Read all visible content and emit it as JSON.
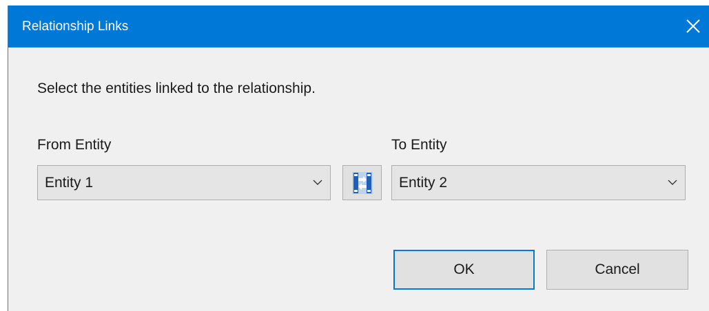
{
  "dialog": {
    "title": "Relationship Links",
    "instruction": "Select the entities linked to the relationship.",
    "from": {
      "label": "From Entity",
      "selected": "Entity 1"
    },
    "to": {
      "label": "To Entity",
      "selected": "Entity 2"
    },
    "buttons": {
      "ok": "OK",
      "cancel": "Cancel"
    },
    "icons": {
      "close": "close-icon",
      "swap": "swap-entities-icon",
      "dropdown": "chevron-down-icon"
    },
    "colors": {
      "titlebar": "#0078d7",
      "background": "#f0f0f0",
      "focus_border": "#0078d7"
    }
  }
}
